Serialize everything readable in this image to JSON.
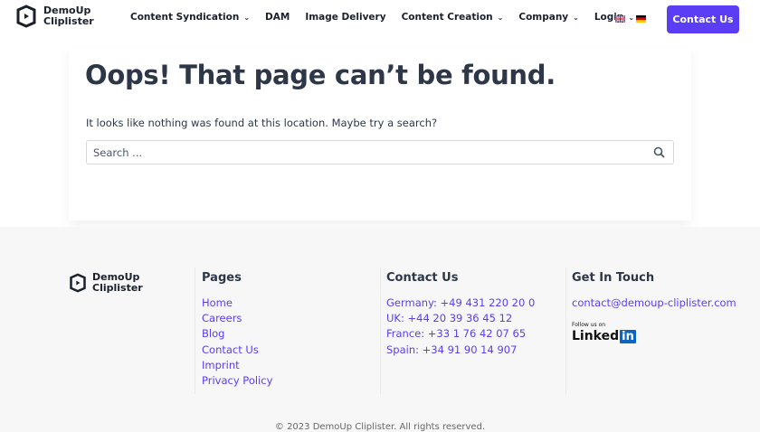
{
  "header": {
    "logo_line1": "DemoUp",
    "logo_line2": "Cliplister",
    "nav": [
      {
        "label": "Content Syndication",
        "dropdown": true
      },
      {
        "label": "DAM",
        "dropdown": false
      },
      {
        "label": "Image Delivery",
        "dropdown": false
      },
      {
        "label": "Content Creation",
        "dropdown": true
      },
      {
        "label": "Company",
        "dropdown": true
      },
      {
        "label": "Login",
        "dropdown": true
      }
    ],
    "languages": [
      "English",
      "German"
    ],
    "cta": "Contact Us"
  },
  "main": {
    "title": "Oops! That page can’t be found.",
    "message": "It looks like nothing was found at this location. Maybe try a search?",
    "search_placeholder": "Search ..."
  },
  "footer": {
    "logo_line1": "DemoUp",
    "logo_line2": "Cliplister",
    "pages": {
      "title": "Pages",
      "links": [
        "Home",
        "Careers",
        "Blog",
        "Contact Us",
        "Imprint",
        "Privacy Policy"
      ]
    },
    "contact": {
      "title": "Contact Us",
      "links": [
        "Germany: +49 431 220 20 0",
        "UK: +44 20 39 36 45 12",
        "France: +33 1 76 42 07 65",
        "Spain: +34 91 90 14 907"
      ]
    },
    "touch": {
      "title": "Get In Touch",
      "email": "contact@demoup-cliplister.com",
      "follow": "Follow us on",
      "linkedin_a": "Linked",
      "linkedin_b": "in"
    },
    "copyright": "© 2023 DemoUp Cliplister. All rights reserved."
  },
  "colors": {
    "accent": "#5b3df5",
    "text": "#2d3748"
  }
}
